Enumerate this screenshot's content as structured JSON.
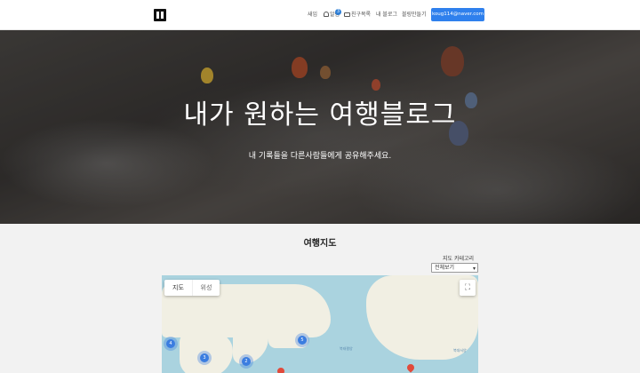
{
  "header": {
    "nav": [
      "새임",
      "알림",
      "친구목록",
      "내 블로그",
      "블링만들기"
    ],
    "notification_count": "3",
    "account": "koug114@naver.com"
  },
  "hero": {
    "title": "내가 원하는 여행블로그",
    "subtitle": "내 기록들을 다른사람들에게 공유해주세요."
  },
  "section": {
    "title": "여행지도",
    "category_label": "지도 카테고리",
    "category_selected": "전체보기"
  },
  "map": {
    "tab_map": "지도",
    "tab_satellite": "위성",
    "clusters": [
      "4",
      "3",
      "5",
      "2"
    ],
    "sea_labels": [
      "북태평양",
      "북대서양"
    ]
  },
  "colors": {
    "accent": "#2f80ed",
    "cluster": "#3b7de0",
    "pin": "#e14a3b",
    "ocean": "#aad3df",
    "land": "#f1efe3"
  }
}
